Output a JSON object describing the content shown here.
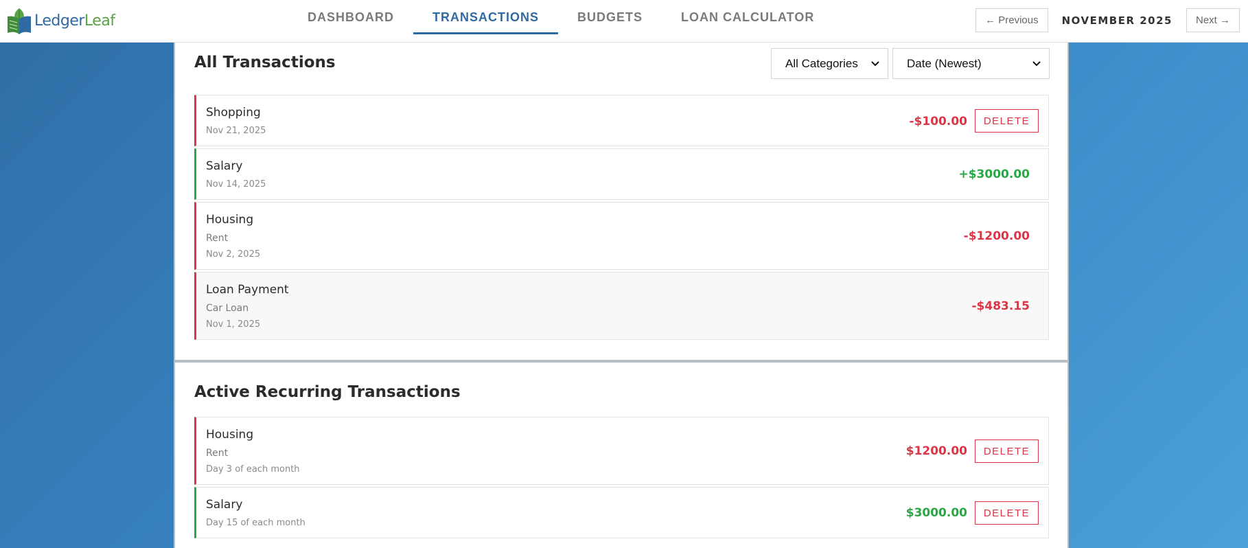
{
  "brand": {
    "name_part1": "Ledger",
    "name_part2": "Leaf",
    "icon": "book-leaf-logo-icon"
  },
  "nav": {
    "tabs": [
      {
        "label": "DASHBOARD",
        "active": false
      },
      {
        "label": "TRANSACTIONS",
        "active": true
      },
      {
        "label": "BUDGETS",
        "active": false
      },
      {
        "label": "LOAN CALCULATOR",
        "active": false
      }
    ]
  },
  "month_nav": {
    "previous_label": "← Previous",
    "current": "NOVEMBER 2025",
    "next_label": "Next →"
  },
  "all_transactions": {
    "title": "All Transactions",
    "category_filter": "All Categories",
    "sort": "Date (Newest)",
    "items": [
      {
        "category": "Shopping",
        "date": "Nov 21, 2025",
        "amount": "-$100.00",
        "type": "expense",
        "delete_label": "DELETE"
      },
      {
        "category": "Salary",
        "date": "Nov 14, 2025",
        "amount": "+$3000.00",
        "type": "income"
      },
      {
        "category": "Housing",
        "description": "Rent",
        "date": "Nov 2, 2025",
        "amount": "-$1200.00",
        "type": "expense"
      },
      {
        "category": "Loan Payment",
        "description": "Car Loan",
        "date": "Nov 1, 2025",
        "amount": "-$483.15",
        "type": "expense"
      }
    ]
  },
  "recurring": {
    "title": "Active Recurring Transactions",
    "items": [
      {
        "category": "Housing",
        "description": "Rent",
        "schedule": "Day 3 of each month",
        "amount": "$1200.00",
        "type": "expense",
        "delete_label": "DELETE"
      },
      {
        "category": "Salary",
        "schedule": "Day 15 of each month",
        "amount": "$3000.00",
        "type": "income",
        "delete_label": "DELETE"
      }
    ]
  },
  "colors": {
    "expense": "#dc3545",
    "income": "#28a745",
    "accent": "#2f6aa3"
  }
}
